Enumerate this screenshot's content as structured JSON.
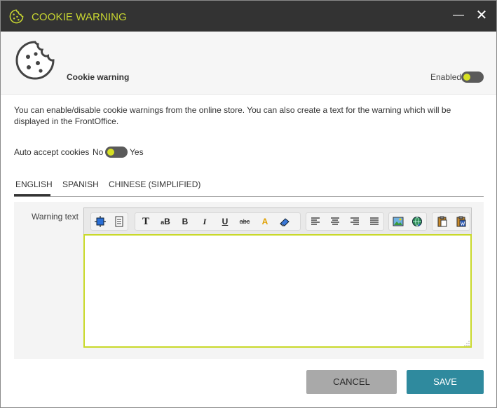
{
  "window": {
    "title": "COOKIE WARNING",
    "minimize_label": "—",
    "close_label": "✕"
  },
  "header": {
    "title": "Cookie warning",
    "enabled_label": "Enabled",
    "enabled": true
  },
  "description": "You can enable/disable cookie warnings from the online store. You can also create a text for the warning which will be displayed in the FrontOffice.",
  "auto_accept": {
    "label": "Auto accept cookies",
    "off_label": "No",
    "on_label": "Yes",
    "value": false
  },
  "tabs": [
    {
      "label": "ENGLISH",
      "active": true
    },
    {
      "label": "SPANISH",
      "active": false
    },
    {
      "label": "CHINESE (SIMPLIFIED)",
      "active": false
    }
  ],
  "editor": {
    "label": "Warning text",
    "content": "",
    "toolbar": [
      "select-all",
      "document",
      "font-family",
      "font-size",
      "bold",
      "italic",
      "underline",
      "strikethrough",
      "text-color",
      "eraser",
      "align-left",
      "align-center",
      "align-right",
      "align-justify",
      "image",
      "link",
      "paste",
      "paste-word"
    ],
    "toolbar_text": {
      "font_family": "T",
      "font_size_small": "a",
      "font_size_big": "B",
      "bold": "B",
      "italic": "I",
      "underline": "U",
      "strike": "abc",
      "text_color": "A"
    }
  },
  "buttons": {
    "cancel": "CANCEL",
    "save": "SAVE"
  },
  "colors": {
    "accent": "#c8d631",
    "toggle_knob": "#d6e023",
    "titlebar": "#333333",
    "save": "#2f8a9e",
    "cancel": "#a9a9a9",
    "editor_border": "#c9d92a"
  }
}
